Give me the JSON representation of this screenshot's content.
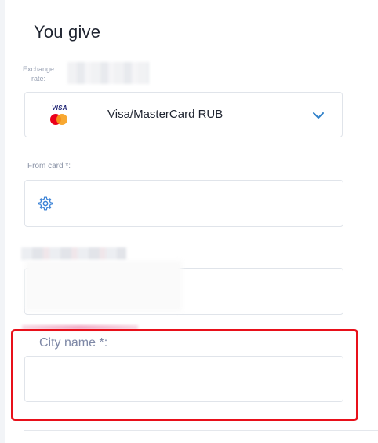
{
  "section": {
    "title": "You give"
  },
  "exchange_rate": {
    "label": "Exchange rate:"
  },
  "payment_select": {
    "value": "Visa/MasterCard RUB",
    "icon": "chevron-down-icon",
    "logo_text": "VISA",
    "accent": "#2f80c9"
  },
  "from_card": {
    "label": "From card *:",
    "value": "",
    "icon": "gear-icon"
  },
  "city": {
    "label": "City name *:",
    "value": "",
    "highlight_color": "#e8101a"
  }
}
